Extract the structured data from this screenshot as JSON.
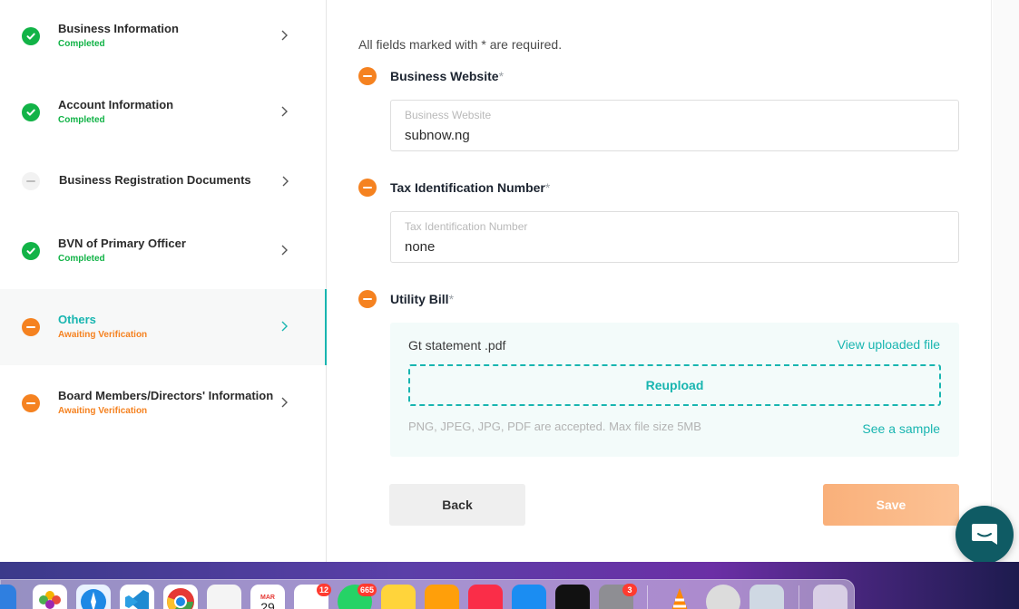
{
  "sidebar": {
    "steps": [
      {
        "title": "Business Information",
        "status": "Completed",
        "state": "done"
      },
      {
        "title": "Account Information",
        "status": "Completed",
        "state": "done"
      },
      {
        "title": "Business Registration Documents",
        "status": "",
        "state": "pending"
      },
      {
        "title": "BVN of Primary Officer",
        "status": "Completed",
        "state": "done"
      },
      {
        "title": "Others",
        "status": "Awaiting Verification",
        "state": "waiting"
      },
      {
        "title": "Board Members/Directors' Information",
        "status": "Awaiting Verification",
        "state": "waiting"
      }
    ],
    "active_step": "Others"
  },
  "form": {
    "required_note": "All fields marked with * are required.",
    "website": {
      "label": "Business Website",
      "required": "*",
      "placeholder": "Business Website",
      "value": "subnow.ng"
    },
    "tin": {
      "label": "Tax Identification Number",
      "required": "*",
      "placeholder": "Tax Identification Number",
      "value": "none"
    },
    "utility": {
      "label": "Utility Bill",
      "required": "*",
      "file_name": "Gt statement .pdf",
      "view_link": "View uploaded file",
      "reupload_label": "Reupload",
      "accepted_text": "PNG, JPEG, JPG, PDF are accepted. Max file size 5MB",
      "sample_link": "See a sample"
    }
  },
  "actions": {
    "back_label": "Back",
    "save_label": "Save"
  },
  "colors": {
    "accent": "#18b5b0",
    "success": "#12b347",
    "warning": "#f58220",
    "chat": "#0f5b64"
  },
  "dock": {
    "badges": {
      "reminders": "12",
      "whatsapp": "665",
      "system_settings": "3"
    },
    "calendar": {
      "month": "MAR",
      "day": "29"
    },
    "apps": [
      "mail-icon",
      "photos-icon",
      "safari-icon",
      "vscode-icon",
      "chrome-icon",
      "textedit-icon",
      "calendar-icon",
      "reminders-icon",
      "whatsapp-icon",
      "notes-icon",
      "pages-icon",
      "music-icon",
      "app-store-icon",
      "apple-tv-icon",
      "system-settings-icon",
      "vlc-icon",
      "quicktime-icon",
      "preview-icon",
      "trash-icon"
    ]
  }
}
